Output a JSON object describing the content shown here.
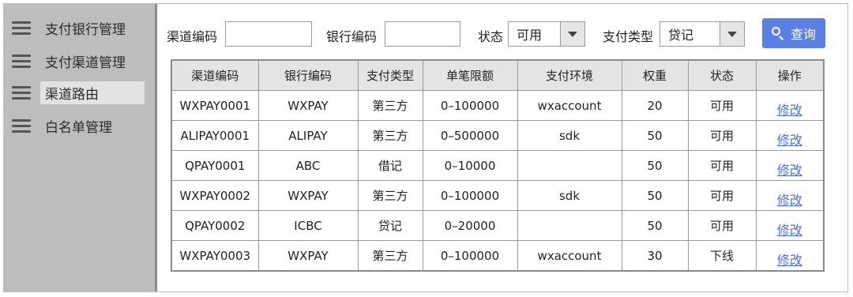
{
  "sidebar": {
    "items": [
      {
        "label": "支付银行管理",
        "icon": "menu-icon"
      },
      {
        "label": "支付渠道管理",
        "icon": "menu-icon"
      },
      {
        "label": "渠道路由",
        "icon": "menu-icon",
        "active": true
      },
      {
        "label": "白名单管理",
        "icon": "menu-icon"
      }
    ]
  },
  "filters": {
    "channel_code_label": "渠道编码",
    "channel_code_value": "",
    "bank_code_label": "银行编码",
    "bank_code_value": "",
    "status_label": "状态",
    "status_value": "可用",
    "pay_type_label": "支付类型",
    "pay_type_value": "贷记",
    "query_label": "查询"
  },
  "table": {
    "headers": [
      "渠道编码",
      "银行编码",
      "支付类型",
      "单笔限额",
      "支付环境",
      "权重",
      "状态",
      "操作"
    ],
    "rows": [
      [
        "WXPAY0001",
        "WXPAY",
        "第三方",
        "0–100000",
        "wxaccount",
        "20",
        "可用",
        "修改"
      ],
      [
        "ALIPAY0001",
        "ALIPAY",
        "第三方",
        "0–500000",
        "sdk",
        "50",
        "可用",
        "修改"
      ],
      [
        "QPAY0001",
        "ABC",
        "借记",
        "0–10000",
        "",
        "50",
        "可用",
        "修改"
      ],
      [
        "WXPAY0002",
        "WXPAY",
        "第三方",
        "0–100000",
        "sdk",
        "50",
        "可用",
        "修改"
      ],
      [
        "QPAY0002",
        "ICBC",
        "贷记",
        "0–20000",
        "",
        "50",
        "可用",
        "修改"
      ],
      [
        "WXPAY0003",
        "WXPAY",
        "第三方",
        "0–100000",
        "wxaccount",
        "30",
        "下线",
        "修改"
      ]
    ]
  },
  "colors": {
    "accent": "#5b7fe3",
    "link": "#4a6fd8",
    "sidebar_bg": "#bdbdbd"
  }
}
